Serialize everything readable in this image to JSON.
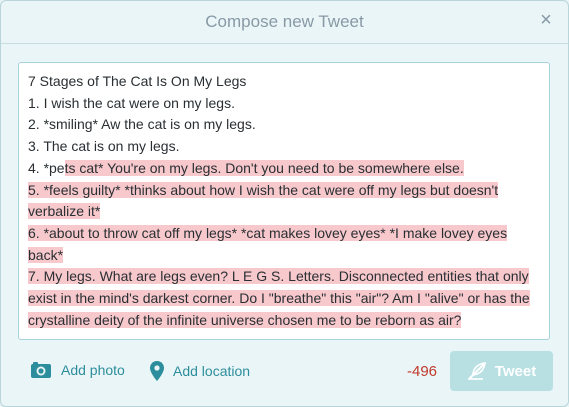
{
  "dialog": {
    "title": "Compose new Tweet",
    "close_symbol": "×"
  },
  "tweet": {
    "lines": [
      {
        "text": "7 Stages of The Cat Is On My Legs"
      },
      {
        "text": "1. I wish the cat were on my legs."
      },
      {
        "text": "2. *smiling* Aw the cat is on my legs."
      },
      {
        "text": "3. The cat is on my legs."
      },
      {
        "pre": "4. *pe",
        "over": "ts cat* You're on my legs. Don't you need to be somewhere else."
      },
      {
        "over": "5. *feels guilty* *thinks about how I wish the cat were off my legs but doesn't verbalize it*"
      },
      {
        "over": "6. *about to throw cat off my legs* *cat makes lovey eyes* *I make lovey eyes back*"
      },
      {
        "over": "7. My legs. What are legs even? L E G S. Letters. Disconnected entities that only exist in the mind's darkest corner. Do I \"breathe\" this \"air\"? Am I \"alive\" or has the crystalline deity of the infinite universe chosen me to be reborn as air?"
      }
    ]
  },
  "toolbar": {
    "add_photo_label": "Add photo",
    "add_location_label": "Add location",
    "char_count": "-496",
    "tweet_label": "Tweet"
  },
  "colors": {
    "accent": "#2c8e9c",
    "overflow_highlight": "#f7c9cc",
    "counter_negative": "#c0392b",
    "tweet_button_disabled": "#b8e0e3"
  },
  "icons": {
    "photo": "camera-icon",
    "location": "map-pin-icon",
    "tweet": "compose-quill-icon",
    "close": "close-icon"
  }
}
